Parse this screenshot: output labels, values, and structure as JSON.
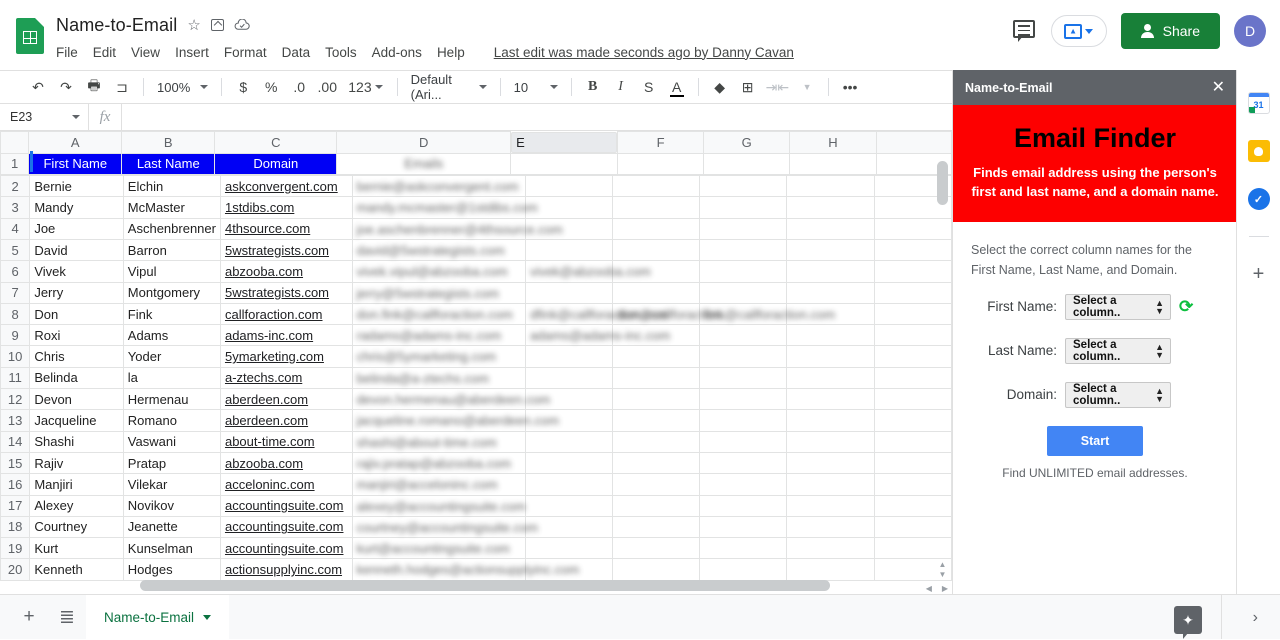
{
  "header": {
    "doc_title": "Name-to-Email",
    "star_icon": "star-icon",
    "move_icon": "move-to-folder-icon",
    "cloud_icon": "cloud-saved-icon",
    "menus": [
      "File",
      "Edit",
      "View",
      "Insert",
      "Format",
      "Data",
      "Tools",
      "Add-ons",
      "Help"
    ],
    "last_edit": "Last edit was made seconds ago by Danny Cavan",
    "share_label": "Share",
    "avatar_initial": "D"
  },
  "toolbar": {
    "undo": "↶",
    "redo": "↷",
    "print": "🖶",
    "paint": "⊐",
    "zoom": "100%",
    "currency": "$",
    "percent": "%",
    "dec_less": ".0",
    "dec_more": ".00",
    "formats": "123",
    "font": "Default (Ari...",
    "font_size": "10",
    "bold": "B",
    "italic": "I",
    "strike": "S",
    "text_color": "A",
    "fill": "◆",
    "borders": "⊞",
    "merge": "⇥⇤",
    "more": "•••",
    "collapse": "⌃"
  },
  "formula_bar": {
    "cell_ref": "E23",
    "fx": "fx",
    "value": ""
  },
  "grid": {
    "columns": [
      "A",
      "B",
      "C",
      "D",
      "E",
      "F",
      "G",
      "H",
      ""
    ],
    "selected_column": "E",
    "header_row": {
      "first_name": "First Name",
      "last_name": "Last Name",
      "domain": "Domain",
      "emails": "Emails"
    },
    "rows": [
      {
        "n": "2",
        "first": "Bernie",
        "last": "Elchin",
        "domain": "askconvergent.com",
        "d": "bernie@askconvergent.com",
        "e": "",
        "f": "",
        "g": ""
      },
      {
        "n": "3",
        "first": "Mandy",
        "last": "McMaster",
        "domain": "1stdibs.com",
        "d": "mandy.mcmaster@1stdibs.com",
        "e": "",
        "f": "",
        "g": ""
      },
      {
        "n": "4",
        "first": "Joe",
        "last": "Aschenbrenner",
        "domain": "4thsource.com",
        "d": "joe.aschenbrenner@4thsource.com",
        "e": "",
        "f": "",
        "g": ""
      },
      {
        "n": "5",
        "first": "David",
        "last": "Barron",
        "domain": "5wstrategists.com",
        "d": "david@5wstrategists.com",
        "e": "",
        "f": "",
        "g": ""
      },
      {
        "n": "6",
        "first": "Vivek",
        "last": "Vipul",
        "domain": "abzooba.com",
        "d": "vivek.vipul@abzooba.com",
        "e": "vivek@abzooba.com",
        "f": "",
        "g": ""
      },
      {
        "n": "7",
        "first": "Jerry",
        "last": "Montgomery",
        "domain": "5wstrategists.com",
        "d": "jerry@5wstrategists.com",
        "e": "",
        "f": "",
        "g": ""
      },
      {
        "n": "8",
        "first": "Don",
        "last": "Fink",
        "domain": "callforaction.com",
        "d": "don.fink@callforaction.com",
        "e": "dfink@callforaction.com",
        "f": "don@callforaction.",
        "g": "fink@callforaction.com"
      },
      {
        "n": "9",
        "first": "Roxi",
        "last": "Adams",
        "domain": "adams-inc.com",
        "d": "radams@adams-inc.com",
        "e": "adams@adams-inc.com",
        "f": "",
        "g": ""
      },
      {
        "n": "10",
        "first": "Chris",
        "last": "Yoder",
        "domain": "5ymarketing.com",
        "d": "chris@5ymarketing.com",
        "e": "",
        "f": "",
        "g": ""
      },
      {
        "n": "11",
        "first": "Belinda",
        "last": "la",
        "domain": "a-ztechs.com",
        "d": "belinda@a-ztechs.com",
        "e": "",
        "f": "",
        "g": ""
      },
      {
        "n": "12",
        "first": "Devon",
        "last": "Hermenau",
        "domain": "aberdeen.com",
        "d": "devon.hermenau@aberdeen.com",
        "e": "",
        "f": "",
        "g": ""
      },
      {
        "n": "13",
        "first": "Jacqueline",
        "last": "Romano",
        "domain": "aberdeen.com",
        "d": "jacqueline.romano@aberdeen.com",
        "e": "",
        "f": "",
        "g": ""
      },
      {
        "n": "14",
        "first": "Shashi",
        "last": "Vaswani",
        "domain": "about-time.com",
        "d": "shashi@about-time.com",
        "e": "",
        "f": "",
        "g": ""
      },
      {
        "n": "15",
        "first": "Rajiv",
        "last": "Pratap",
        "domain": "abzooba.com",
        "d": "rajiv.pratap@abzooba.com",
        "e": "",
        "f": "",
        "g": ""
      },
      {
        "n": "16",
        "first": "Manjiri",
        "last": "Vilekar",
        "domain": "acceloninc.com",
        "d": "manjiri@acceloninc.com",
        "e": "",
        "f": "",
        "g": ""
      },
      {
        "n": "17",
        "first": "Alexey",
        "last": "Novikov",
        "domain": "accountingsuite.com",
        "d": "alexey@accountingsuite.com",
        "e": "",
        "f": "",
        "g": ""
      },
      {
        "n": "18",
        "first": "Courtney",
        "last": "Jeanette",
        "domain": "accountingsuite.com",
        "d": "courtney@accountingsuite.com",
        "e": "",
        "f": "",
        "g": ""
      },
      {
        "n": "19",
        "first": "Kurt",
        "last": "Kunselman",
        "domain": "accountingsuite.com",
        "d": "kurt@accountingsuite.com",
        "e": "",
        "f": "",
        "g": ""
      },
      {
        "n": "20",
        "first": "Kenneth",
        "last": "Hodges",
        "domain": "actionsupplyinc.com",
        "d": "kenneth.hodges@actionsupplyinc.com",
        "e": "",
        "f": "",
        "g": ""
      }
    ]
  },
  "addon": {
    "title": "Name-to-Email",
    "close_icon": "close-icon",
    "banner_title": "Email Finder",
    "banner_text": "Finds email address using the person's first and last name, and a domain name.",
    "instructions": "Select the correct column names for the First Name, Last Name, and Domain.",
    "fields": [
      {
        "label": "First Name:",
        "value": "Select a column..",
        "has_refresh": true
      },
      {
        "label": "Last Name:",
        "value": "Select a column..",
        "has_refresh": false
      },
      {
        "label": "Domain:",
        "value": "Select a column..",
        "has_refresh": false
      }
    ],
    "start_label": "Start",
    "footer_note": "Find UNLIMITED email addresses.",
    "refresh_icon": "refresh-icon",
    "accent_red": "#fd0000",
    "accent_blue": "#4285f4"
  },
  "rail": {
    "items": [
      "calendar-icon",
      "keep-icon",
      "tasks-icon"
    ],
    "calendar_day": "31",
    "tasks_glyph": "✓",
    "add_label": "+"
  },
  "bottom": {
    "add_sheet": "+",
    "all_sheets": "≣",
    "tab_name": "Name-to-Email",
    "explore_icon": "explore-icon",
    "chevron": "›"
  }
}
